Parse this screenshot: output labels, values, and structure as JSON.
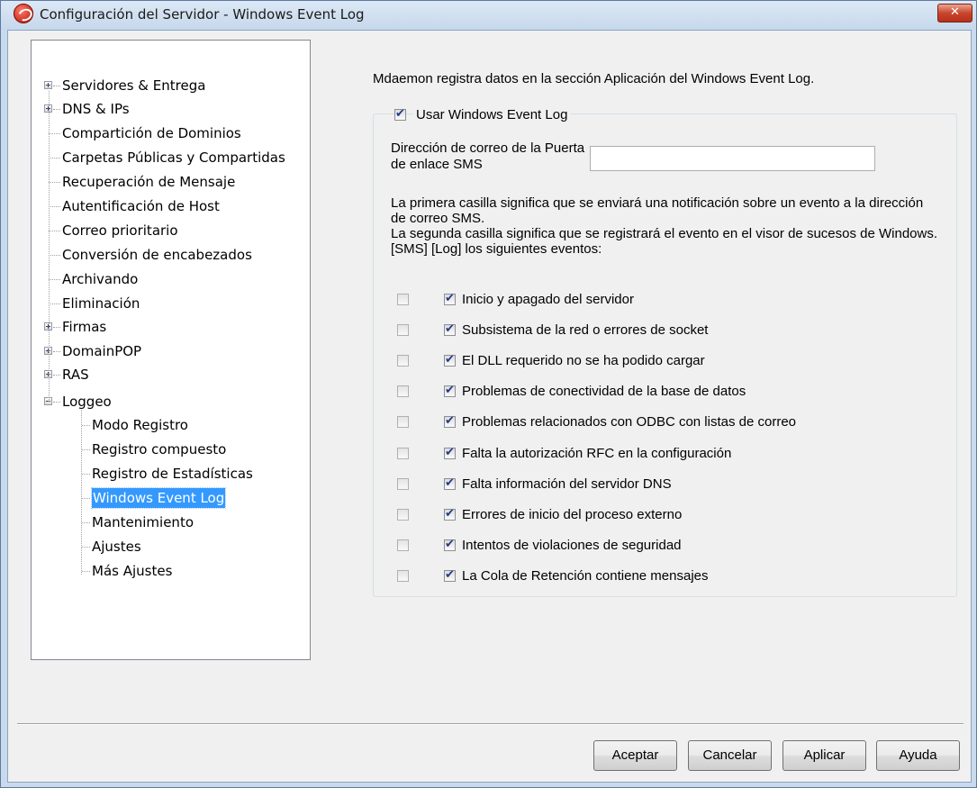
{
  "window": {
    "title": "Configuración del Servidor - Windows Event Log",
    "close_glyph": "✕"
  },
  "tree": {
    "items": [
      {
        "label": "Servidores & Entrega",
        "expander": "plus"
      },
      {
        "label": "DNS & IPs",
        "expander": "plus"
      },
      {
        "label": "Compartición de Dominios"
      },
      {
        "label": "Carpetas Públicas y Compartidas"
      },
      {
        "label": "Recuperación de Mensaje"
      },
      {
        "label": "Autentificación de Host"
      },
      {
        "label": "Correo prioritario"
      },
      {
        "label": "Conversión de encabezados"
      },
      {
        "label": "Archivando"
      },
      {
        "label": "Eliminación"
      },
      {
        "label": "Firmas",
        "expander": "plus"
      },
      {
        "label": "DomainPOP",
        "expander": "plus"
      },
      {
        "label": "RAS",
        "expander": "plus"
      },
      {
        "label": "Loggeo",
        "expander": "minus"
      }
    ],
    "children": [
      {
        "label": "Modo Registro"
      },
      {
        "label": "Registro compuesto"
      },
      {
        "label": "Registro de Estadísticas"
      },
      {
        "label": "Windows Event Log",
        "selected": true
      },
      {
        "label": "Mantenimiento"
      },
      {
        "label": "Ajustes"
      },
      {
        "label": "Más Ajustes"
      }
    ]
  },
  "panel": {
    "intro": "Mdaemon registra datos en la sección Aplicación del Windows Event Log.",
    "use_event_log": {
      "label": "Usar Windows Event Log",
      "checked": true
    },
    "gateway_label": "Dirección de correo de la Puerta de enlace SMS",
    "gateway_value": "",
    "description_lines": [
      "La primera casilla significa que se enviará una notificación sobre un evento a la dirección de correo SMS.",
      "La segunda casilla significa que se registrará el evento en el visor de sucesos de Windows.",
      "[SMS]  [Log] los siguientes eventos:"
    ],
    "events": [
      {
        "label": "Inicio y apagado del servidor",
        "sms": false,
        "log": true
      },
      {
        "label": "Subsistema de la red o errores de socket",
        "sms": false,
        "log": true
      },
      {
        "label": "El DLL requerido no se ha podido cargar",
        "sms": false,
        "log": true
      },
      {
        "label": "Problemas de conectividad de la base de datos",
        "sms": false,
        "log": true
      },
      {
        "label": "Problemas relacionados con ODBC con listas de correo",
        "sms": false,
        "log": true
      },
      {
        "label": "Falta la autorización RFC en la configuración",
        "sms": false,
        "log": true
      },
      {
        "label": "Falta información del servidor DNS",
        "sms": false,
        "log": true
      },
      {
        "label": "Errores de inicio del proceso externo",
        "sms": false,
        "log": true
      },
      {
        "label": "Intentos de violaciones de seguridad",
        "sms": false,
        "log": true
      },
      {
        "label": "La Cola de Retención contiene mensajes",
        "sms": false,
        "log": true
      }
    ]
  },
  "buttons": {
    "ok": "Aceptar",
    "cancel": "Cancelar",
    "apply": "Aplicar",
    "help": "Ayuda"
  }
}
